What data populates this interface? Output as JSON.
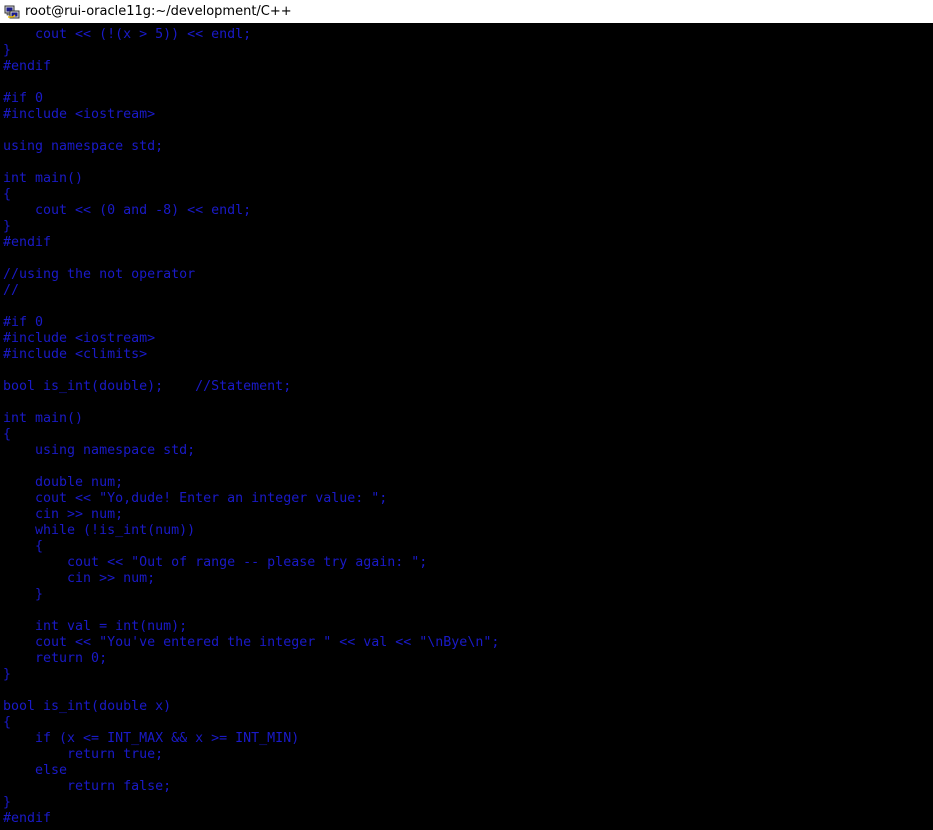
{
  "window": {
    "title": "root@rui-oracle11g:~/development/C++",
    "icon": "putty-terminal-icon"
  },
  "colors": {
    "background": "#000000",
    "text": "#1a1ac8",
    "titlebar": "#ffffff"
  },
  "terminal": {
    "lines": [
      "    cout << (!(x > 5)) << endl;",
      "}",
      "#endif",
      "",
      "#if 0",
      "#include <iostream>",
      "",
      "using namespace std;",
      "",
      "int main()",
      "{",
      "    cout << (0 and -8) << endl;",
      "}",
      "#endif",
      "",
      "//using the not operator",
      "//",
      "",
      "#if 0",
      "#include <iostream>",
      "#include <climits>",
      "",
      "bool is_int(double);    //Statement;",
      "",
      "int main()",
      "{",
      "    using namespace std;",
      "",
      "    double num;",
      "    cout << \"Yo,dude! Enter an integer value: \";",
      "    cin >> num;",
      "    while (!is_int(num))",
      "    {",
      "        cout << \"Out of range -- please try again: \";",
      "        cin >> num;",
      "    }",
      "",
      "    int val = int(num);",
      "    cout << \"You've entered the integer \" << val << \"\\nBye\\n\";",
      "    return 0;",
      "}",
      "",
      "bool is_int(double x)",
      "{",
      "    if (x <= INT_MAX && x >= INT_MIN)",
      "        return true;",
      "    else",
      "        return false;",
      "}",
      "#endif"
    ]
  }
}
